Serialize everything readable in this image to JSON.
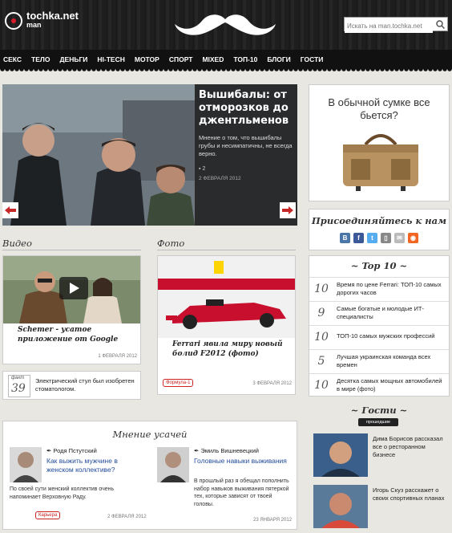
{
  "site": {
    "logo_text": "tochka.net",
    "logo_sub": "man"
  },
  "search": {
    "placeholder": "Искать на man.tochka.net"
  },
  "nav": [
    "СЕКС",
    "ТЕЛО",
    "ДЕНЬГИ",
    "HI-TECH",
    "МОТОР",
    "СПОРТ",
    "MIXED",
    "ТОП-10",
    "БЛОГИ",
    "ГОСТИ"
  ],
  "featured": {
    "title": "Вышибалы: от отморозков до джентльменов",
    "description": "Мнение о том, что вышибалы грубы и несимпатичны, не всегда верно.",
    "comments": "2",
    "date": "2 ФЕВРАЛЯ 2012"
  },
  "ad": {
    "text": "В обычной сумке все бьется?"
  },
  "join": {
    "title": "Присоединяйтесь к нам"
  },
  "social": [
    {
      "name": "vk-icon",
      "glyph": "В",
      "color": "#4a76a8"
    },
    {
      "name": "facebook-icon",
      "glyph": "f",
      "color": "#3b5998"
    },
    {
      "name": "twitter-icon",
      "glyph": "t",
      "color": "#55acee"
    },
    {
      "name": "mobile-icon",
      "glyph": "▯",
      "color": "#888888"
    },
    {
      "name": "mail-icon",
      "glyph": "✉",
      "color": "#bbbbbb"
    },
    {
      "name": "rss-icon",
      "glyph": "◉",
      "color": "#f26522"
    }
  ],
  "video": {
    "section": "Видео",
    "caption": "Schemer - усатое приложение от Google",
    "date": "1 ФЕВРАЛЯ 2012"
  },
  "photo": {
    "section": "Фото",
    "caption": "Ferrari явила миру новый болид F2012 (фото)",
    "tag": "Формула-1",
    "date": "3 ФЕВРАЛЯ 2012"
  },
  "fact": {
    "label": "факт",
    "number": "39",
    "text": "Электрический стул был изобретен стоматологом."
  },
  "top10": {
    "title": "~ Top 10 ~",
    "items": [
      {
        "num": "10",
        "text": "Время по цене Ferrari: ТОП-10 самых дорогих часов"
      },
      {
        "num": "9",
        "text": "Самые богатые и молодые ИТ-специалисты"
      },
      {
        "num": "10",
        "text": "ТОП-10 самых мужских профессий"
      },
      {
        "num": "5",
        "text": "Лучшая украинская команда всех времен"
      },
      {
        "num": "10",
        "text": "Десятка самых мощных автомобилей в мире (фото)"
      }
    ]
  },
  "opinions": {
    "title": "Мнение усачей",
    "items": [
      {
        "author": "Родя Пстутский",
        "headline": "Как выжить мужчине в женском коллективе?",
        "text": "По своей сути женский коллектив очень напоминает Верховную Раду.",
        "tag": "Карьера",
        "date": "2 ФЕВРАЛЯ 2012"
      },
      {
        "author": "Эмиль Вишневецкий",
        "headline": "Головные навыки выживания",
        "text": "В прошлый раз я обещал пополнить набор навыков выживания пятеркой тех, которые зависят от твоей головы.",
        "date": "23 ЯНВАРЯ 2012"
      }
    ]
  },
  "guests": {
    "title": "~ Гости ~",
    "badge": "прошедшие",
    "items": [
      {
        "text": "Дима Борисов рассказал все о ресторанном бизнесе"
      },
      {
        "text": "Игорь Скуз расскажет о своих спортивных планах"
      }
    ]
  }
}
